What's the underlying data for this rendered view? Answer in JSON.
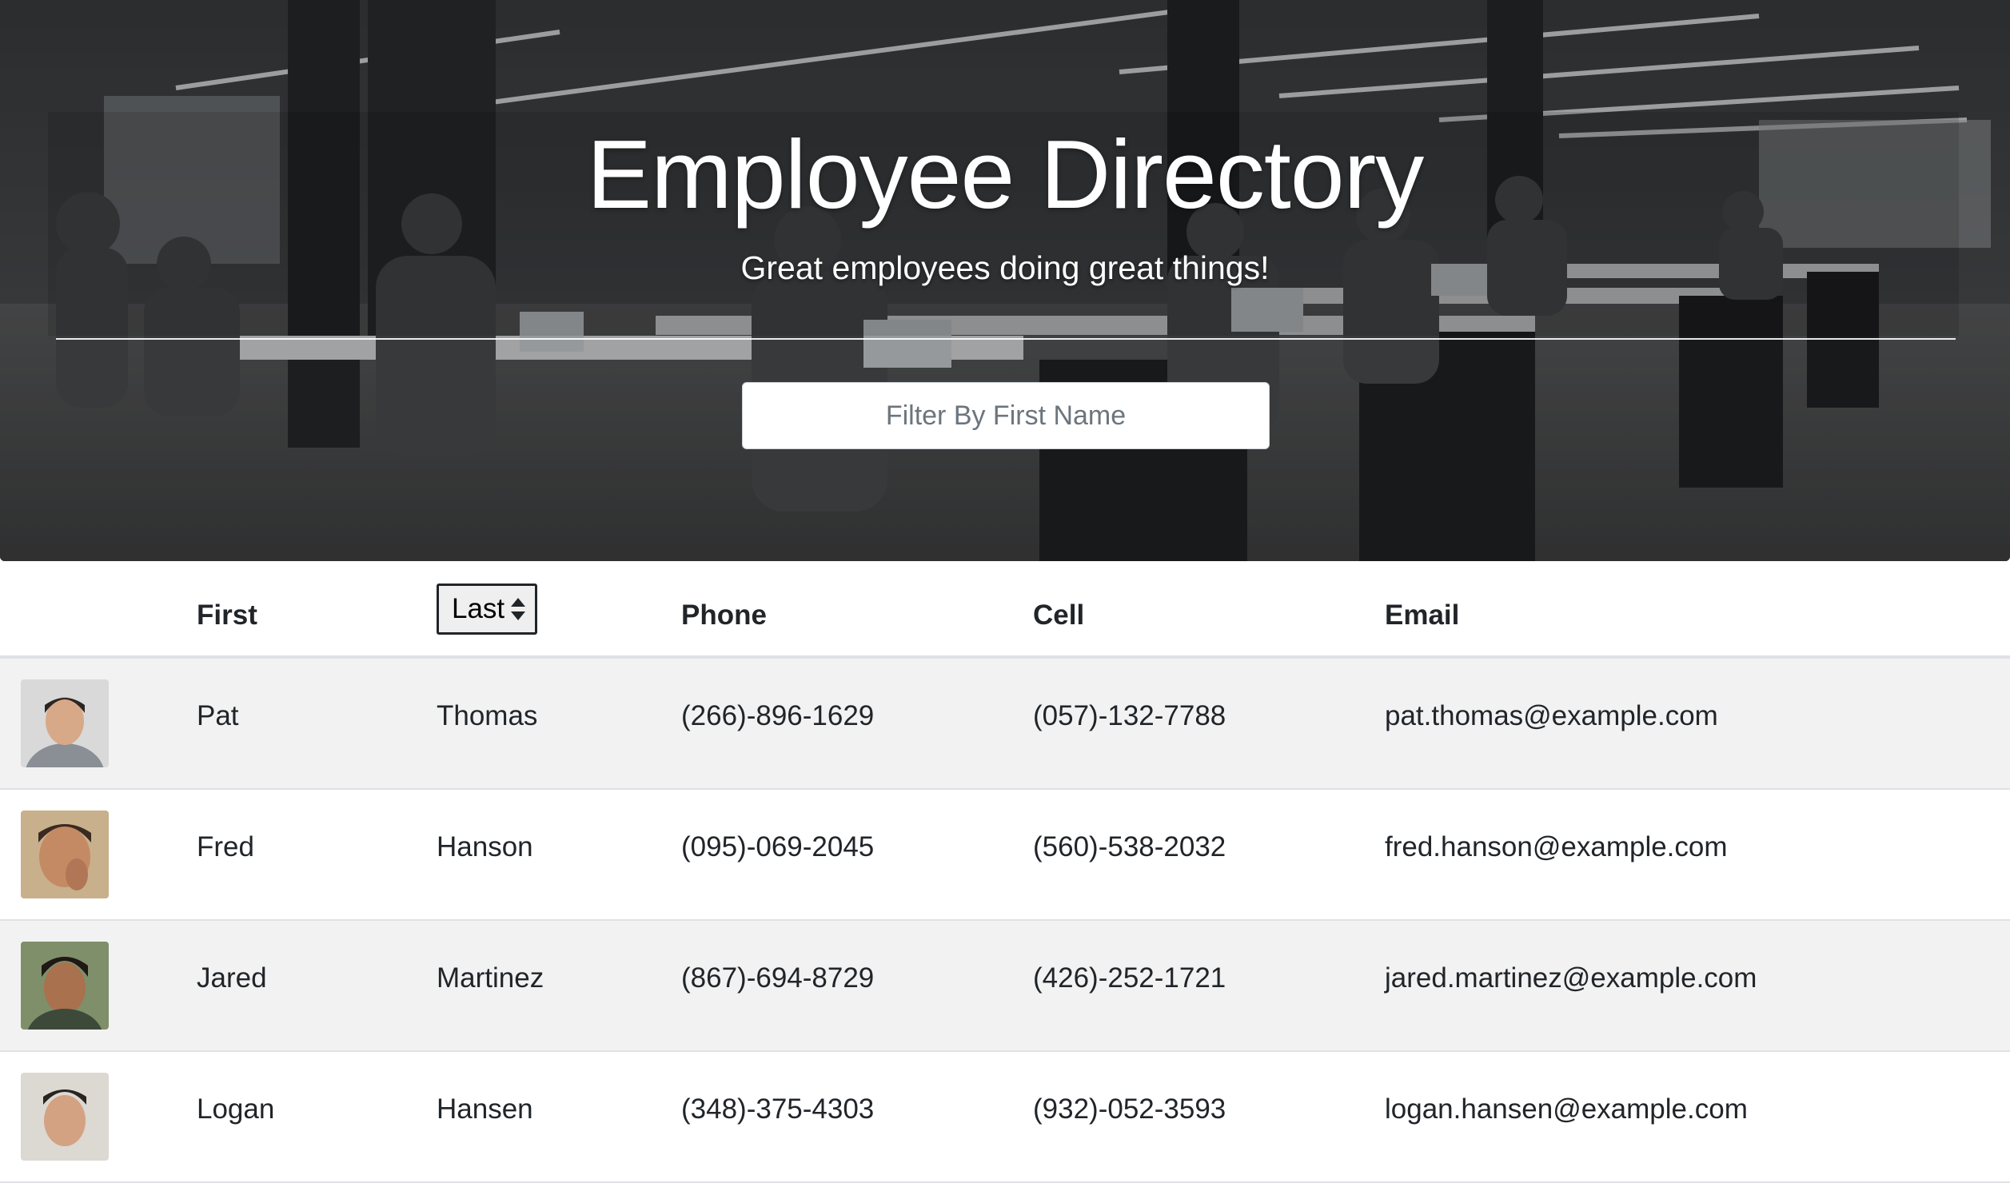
{
  "hero": {
    "title": "Employee Directory",
    "subtitle": "Great employees doing great things!",
    "filter_placeholder": "Filter By First Name"
  },
  "table": {
    "headers": {
      "first": "First",
      "last": "Last",
      "phone": "Phone",
      "cell": "Cell",
      "email": "Email"
    },
    "sort_icon": "sort-up-down-icon",
    "rows": [
      {
        "first": "Pat",
        "last": "Thomas",
        "phone": "(266)-896-1629",
        "cell": "(057)-132-7788",
        "email": "pat.thomas@example.com"
      },
      {
        "first": "Fred",
        "last": "Hanson",
        "phone": "(095)-069-2045",
        "cell": "(560)-538-2032",
        "email": "fred.hanson@example.com"
      },
      {
        "first": "Jared",
        "last": "Martinez",
        "phone": "(867)-694-8729",
        "cell": "(426)-252-1721",
        "email": "jared.martinez@example.com"
      },
      {
        "first": "Logan",
        "last": "Hansen",
        "phone": "(348)-375-4303",
        "cell": "(932)-052-3593",
        "email": "logan.hansen@example.com"
      }
    ]
  },
  "colors": {
    "stripe": "#f2f2f2",
    "border": "#dee2e6",
    "text": "#212529"
  }
}
